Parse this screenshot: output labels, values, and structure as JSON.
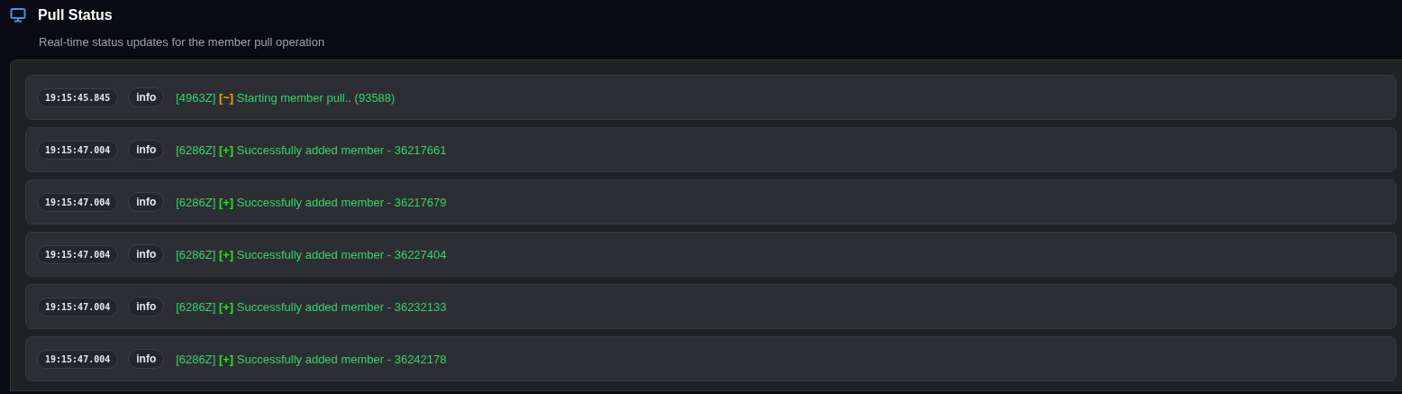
{
  "header": {
    "title": "Pull Status",
    "subtitle": "Real-time status updates for the member pull operation"
  },
  "log": [
    {
      "time": "19:15:45.845",
      "level": "info",
      "tag": "[4963Z]",
      "marker": "[~]",
      "kind": "progress",
      "message": "Starting member pull.. (93588)"
    },
    {
      "time": "19:15:47.004",
      "level": "info",
      "tag": "[6286Z]",
      "marker": "[+]",
      "kind": "success",
      "message": "Successfully added member - 36217661"
    },
    {
      "time": "19:15:47.004",
      "level": "info",
      "tag": "[6286Z]",
      "marker": "[+]",
      "kind": "success",
      "message": "Successfully added member - 36217679"
    },
    {
      "time": "19:15:47.004",
      "level": "info",
      "tag": "[6286Z]",
      "marker": "[+]",
      "kind": "success",
      "message": "Successfully added member - 36227404"
    },
    {
      "time": "19:15:47.004",
      "level": "info",
      "tag": "[6286Z]",
      "marker": "[+]",
      "kind": "success",
      "message": "Successfully added member - 36232133"
    },
    {
      "time": "19:15:47.004",
      "level": "info",
      "tag": "[6286Z]",
      "marker": "[+]",
      "kind": "success",
      "message": "Successfully added member - 36242178"
    }
  ]
}
